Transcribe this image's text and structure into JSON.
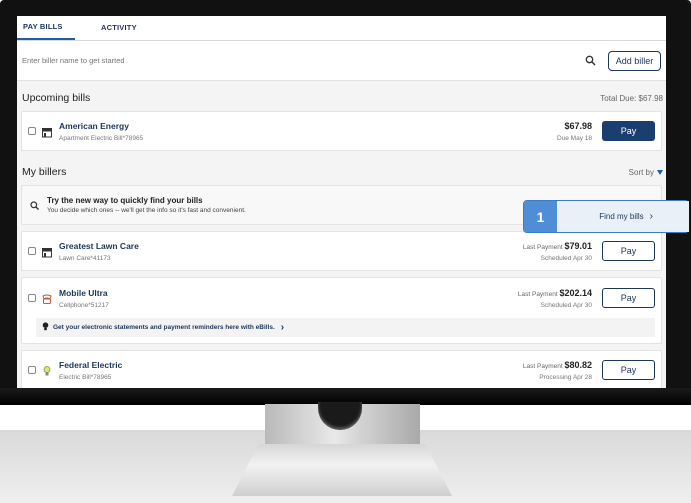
{
  "tabs": [
    {
      "label": "PAY BILLS",
      "active": true
    },
    {
      "label": "ACTIVITY",
      "active": false
    }
  ],
  "search": {
    "placeholder": "Enter biller name to get started",
    "add_biller_label": "Add biller"
  },
  "upcoming": {
    "title": "Upcoming bills",
    "total_due": "Total Due: $67.98",
    "bills": [
      {
        "name": "American Energy",
        "sub": "Apartment Electric Bill*78965",
        "amount": "$67.98",
        "due": "Due May 18",
        "pay_label": "Pay"
      }
    ]
  },
  "billers": {
    "title": "My billers",
    "sort_label": "Sort by",
    "promo": {
      "title": "Try the new way to quickly find your bills",
      "subtitle": "You decide which ones -- we'll get the info so it's fast and convenient.",
      "button_label": "Find my bills"
    },
    "list": [
      {
        "name": "Greatest Lawn Care",
        "sub": "Lawn Care*41173",
        "last_label": "Last Payment",
        "amount": "$79.01",
        "status": "Scheduled Apr 30",
        "pay_label": "Pay"
      },
      {
        "name": "Mobile Ultra",
        "sub": "Cellphone*51217",
        "last_label": "Last Payment",
        "amount": "$202.14",
        "status": "Scheduled Apr 30",
        "pay_label": "Pay",
        "ebill_text": "Get your electronic statements and payment reminders here with eBills."
      },
      {
        "name": "Federal Electric",
        "sub": "Electric Bill*78965",
        "last_label": "Last Payment",
        "amount": "$80.82",
        "status": "Processing Apr 28",
        "pay_label": "Pay"
      }
    ]
  },
  "callout": {
    "number": "1"
  },
  "colors": {
    "primary": "#1a3e6e",
    "accent": "#4f8ed6",
    "link": "#1d3557"
  }
}
